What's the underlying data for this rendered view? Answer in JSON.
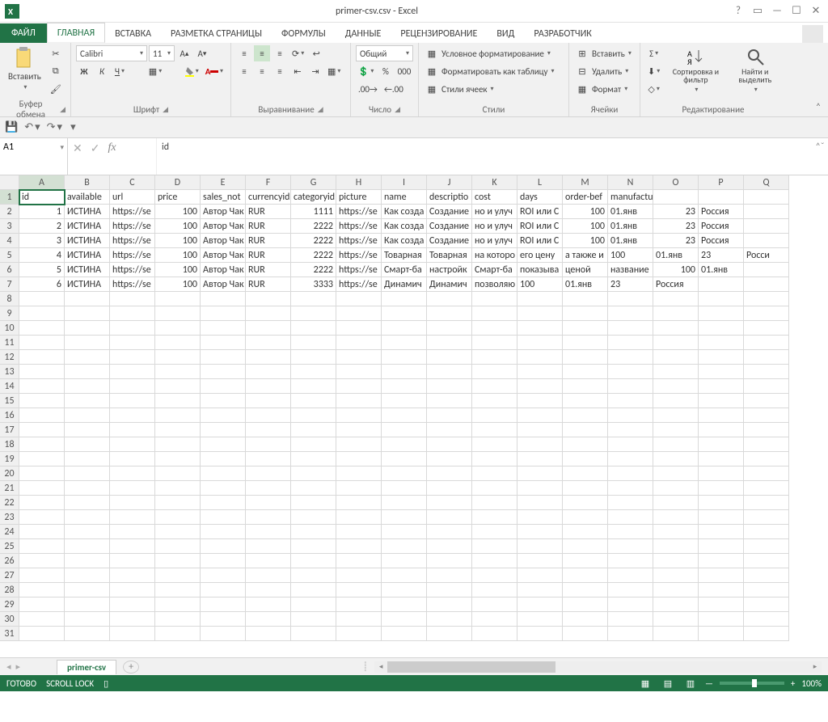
{
  "title": "primer-csv.csv - Excel",
  "tabs": {
    "file": "ФАЙЛ",
    "home": "ГЛАВНАЯ",
    "insert": "ВСТАВКА",
    "layout": "РАЗМЕТКА СТРАНИЦЫ",
    "formulas": "ФОРМУЛЫ",
    "data": "ДАННЫЕ",
    "review": "РЕЦЕНЗИРОВАНИЕ",
    "view": "ВИД",
    "dev": "РАЗРАБОТЧИК"
  },
  "ribbon": {
    "clipboard": {
      "paste": "Вставить",
      "label": "Буфер обмена"
    },
    "font": {
      "name": "Calibri",
      "size": "11",
      "label": "Шрифт"
    },
    "align": {
      "label": "Выравнивание"
    },
    "number": {
      "format": "Общий",
      "label": "Число"
    },
    "styles": {
      "cond": "Условное форматирование",
      "table": "Форматировать как таблицу",
      "cell": "Стили ячеек",
      "label": "Стили"
    },
    "cells": {
      "insert": "Вставить",
      "delete": "Удалить",
      "format": "Формат",
      "label": "Ячейки"
    },
    "editing": {
      "sort": "Сортировка и фильтр",
      "find": "Найти и выделить",
      "label": "Редактирование"
    }
  },
  "namebox": "A1",
  "formula": "id",
  "columns": [
    "A",
    "B",
    "C",
    "D",
    "E",
    "F",
    "G",
    "H",
    "I",
    "J",
    "K",
    "L",
    "M",
    "N",
    "O",
    "P",
    "Q"
  ],
  "rows_count": 31,
  "headers": [
    "id",
    "available",
    "url",
    "price",
    "sales_not",
    "currencyid",
    "categoryid",
    "picture",
    "name",
    "descriptio",
    "cost",
    "days",
    "order-bef",
    "manufacturer_warranty",
    "",
    "",
    ""
  ],
  "data": [
    [
      "1",
      "ИСТИНА",
      "https://se",
      "100",
      "Автор Чак",
      "RUR",
      "1111",
      "https://se",
      "Как созда",
      "Создание",
      "но и улуч",
      "ROI или C",
      "100",
      "01.янв",
      "23",
      "Россия",
      ""
    ],
    [
      "2",
      "ИСТИНА",
      "https://se",
      "100",
      "Автор Чак",
      "RUR",
      "2222",
      "https://se",
      "Как созда",
      "Создание",
      "но и улуч",
      "ROI или C",
      "100",
      "01.янв",
      "23",
      "Россия",
      ""
    ],
    [
      "3",
      "ИСТИНА",
      "https://se",
      "100",
      "Автор Чак",
      "RUR",
      "2222",
      "https://se",
      "Как созда",
      "Создание",
      "но и улуч",
      "ROI или C",
      "100",
      "01.янв",
      "23",
      "Россия",
      ""
    ],
    [
      "4",
      "ИСТИНА",
      "https://se",
      "100",
      "Автор Чак",
      "RUR",
      "2222",
      "https://se",
      "Товарная",
      "Товарная",
      "на которо",
      "его цену",
      "а также и",
      "100",
      "01.янв",
      "23",
      "Росси"
    ],
    [
      "5",
      "ИСТИНА",
      "https://se",
      "100",
      "Автор Чак",
      "RUR",
      "2222",
      "https://se",
      "Смарт-ба",
      "настройк",
      "Смарт-ба",
      "показыва",
      "ценой",
      "название",
      "100",
      "01.янв",
      ""
    ],
    [
      "6",
      "ИСТИНА",
      "https://se",
      "100",
      "Автор Чак",
      "RUR",
      "3333",
      "https://se",
      "Динамич",
      "Динамич",
      "позволяю",
      "100",
      "01.янв",
      "23",
      "Россия",
      "",
      ""
    ]
  ],
  "numeric_cols": [
    0,
    3,
    6,
    12,
    14
  ],
  "sheet": {
    "name": "primer-csv"
  },
  "status": {
    "ready": "ГОТОВО",
    "scroll": "SCROLL LOCK",
    "zoom": "100%"
  }
}
